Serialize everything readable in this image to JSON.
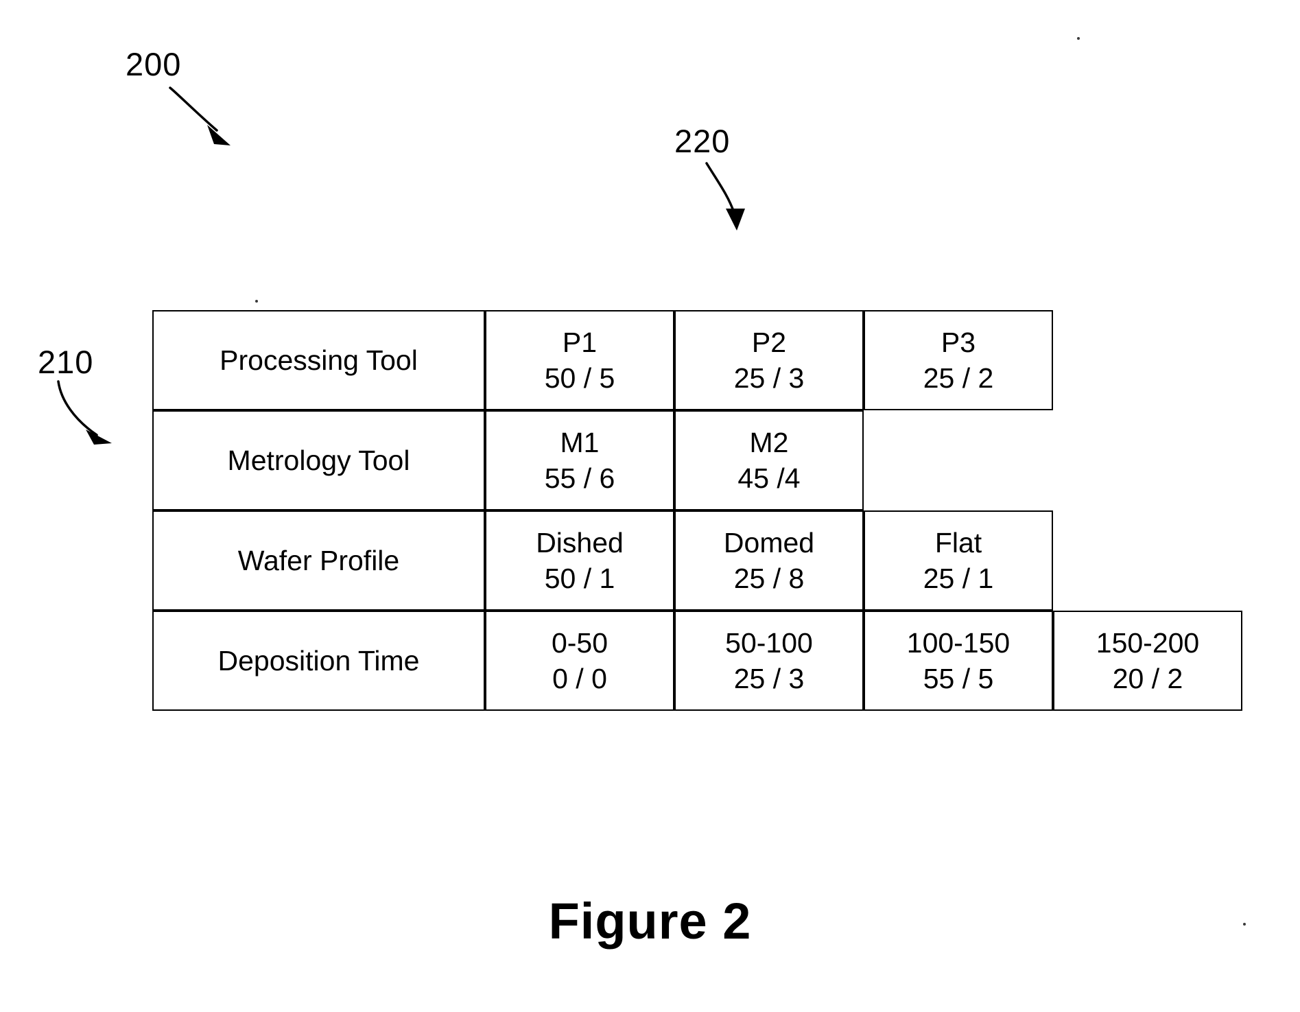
{
  "figure": {
    "caption": "Figure 2",
    "callouts": [
      {
        "id": "ref-200",
        "number": "200",
        "arrow": "diagonal-down-right-arrow"
      },
      {
        "id": "ref-220",
        "number": "220",
        "arrow": "curved-down-arrow"
      },
      {
        "id": "ref-210",
        "number": "210",
        "arrow": "curved-down-right-arrow"
      }
    ]
  },
  "table": {
    "rows": [
      {
        "label": "Processing Tool",
        "cells": [
          {
            "title": "P1",
            "stat": "50 / 5"
          },
          {
            "title": "P2",
            "stat": "25 / 3"
          },
          {
            "title": "P3",
            "stat": "25 / 2"
          }
        ]
      },
      {
        "label": "Metrology Tool",
        "cells": [
          {
            "title": "M1",
            "stat": "55 / 6"
          },
          {
            "title": "M2",
            "stat": "45 /4"
          }
        ]
      },
      {
        "label": "Wafer Profile",
        "cells": [
          {
            "title": "Dished",
            "stat": "50 / 1"
          },
          {
            "title": "Domed",
            "stat": "25 / 8"
          },
          {
            "title": "Flat",
            "stat": "25 / 1"
          }
        ]
      },
      {
        "label": "Deposition Time",
        "cells": [
          {
            "title": "0-50",
            "stat": "0 / 0"
          },
          {
            "title": "50-100",
            "stat": "25 / 3"
          },
          {
            "title": "100-150",
            "stat": "55 / 5"
          },
          {
            "title": "150-200",
            "stat": "20 / 2"
          }
        ]
      }
    ]
  }
}
